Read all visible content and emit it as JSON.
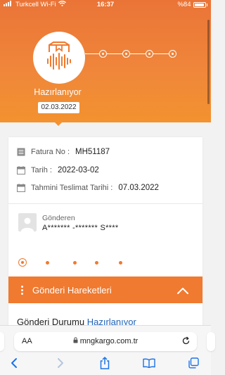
{
  "status_bar": {
    "carrier": "Turkcell Wi-Fi",
    "time": "16:37",
    "battery": "%84",
    "battery_level": 0.84
  },
  "shipment": {
    "status_label": "Hazırlanıyor",
    "status_date": "02.03.2022",
    "status_icon": "package-icon",
    "progress_total_steps": 5,
    "progress_current_step": 1
  },
  "info": {
    "invoice_label": "Fatura No :",
    "invoice_value": "MH51187",
    "date_label": "Tarih :",
    "date_value": "2022-03-02",
    "eta_label": "Tahmini Teslimat Tarihi :",
    "eta_value": "07.03.2022"
  },
  "sender": {
    "label": "Gönderen",
    "name": "A******* -******* S****"
  },
  "movements": {
    "title": "Gönderi Hareketleri"
  },
  "delivery_status": {
    "label": "Gönderi Durumu",
    "value": "Hazırlanıyor"
  },
  "browser": {
    "aa_label": "AA",
    "url": "mngkargo.com.tr"
  },
  "colors": {
    "brand_orange": "#f07a2f",
    "link_blue": "#1e63b8",
    "ios_blue": "#1a73e8"
  }
}
